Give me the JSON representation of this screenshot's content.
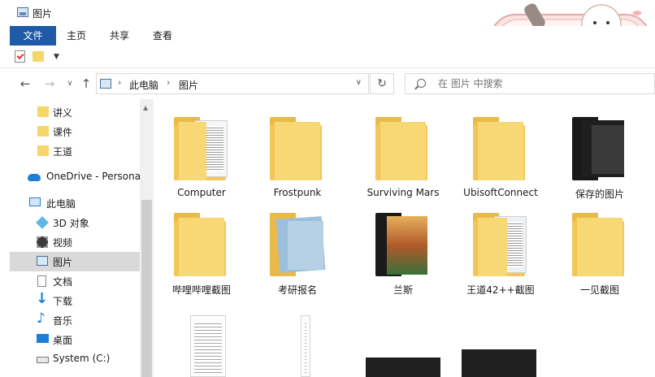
{
  "window": {
    "title": "图片"
  },
  "ribbon": {
    "tabs": [
      {
        "label": "文件",
        "active": true
      },
      {
        "label": "主页"
      },
      {
        "label": "共享"
      },
      {
        "label": "查看"
      }
    ]
  },
  "address": {
    "crumbs": [
      "此电脑",
      "图片"
    ],
    "search_placeholder": "在 图片 中搜索"
  },
  "nav": {
    "items": [
      {
        "label": "讲义",
        "icon": "folder-icon"
      },
      {
        "label": "课件",
        "icon": "folder-icon"
      },
      {
        "label": "王道",
        "icon": "folder-icon"
      },
      {
        "label": "OneDrive - Persona",
        "icon": "onedrive-cloud-icon"
      },
      {
        "label": "此电脑",
        "icon": "computer-icon"
      },
      {
        "label": "3D 对象",
        "icon": "3d-objects-icon"
      },
      {
        "label": "视频",
        "icon": "video-icon"
      },
      {
        "label": "图片",
        "icon": "pictures-icon",
        "selected": true
      },
      {
        "label": "文档",
        "icon": "documents-icon"
      },
      {
        "label": "下载",
        "icon": "download-icon"
      },
      {
        "label": "音乐",
        "icon": "music-icon"
      },
      {
        "label": "桌面",
        "icon": "desktop-icon"
      },
      {
        "label": "System (C:)",
        "icon": "drive-icon"
      }
    ]
  },
  "content": {
    "items": [
      {
        "label": "Computer",
        "kind": "folder-docs"
      },
      {
        "label": "Frostpunk",
        "kind": "folder"
      },
      {
        "label": "Surviving Mars",
        "kind": "folder"
      },
      {
        "label": "UbisoftConnect",
        "kind": "folder"
      },
      {
        "label": "保存的图片",
        "kind": "folder-dark"
      },
      {
        "label": "哔哩哔哩截图",
        "kind": "folder"
      },
      {
        "label": "考研报名",
        "kind": "folder-blue"
      },
      {
        "label": "兰斯",
        "kind": "folder-anime"
      },
      {
        "label": "王道42++截图",
        "kind": "folder-docs"
      },
      {
        "label": "一见截图",
        "kind": "folder"
      }
    ]
  },
  "colors": {
    "accent": "#1e5aa8",
    "folder": "#f8d775",
    "selected_bg": "#d9d9d9"
  }
}
